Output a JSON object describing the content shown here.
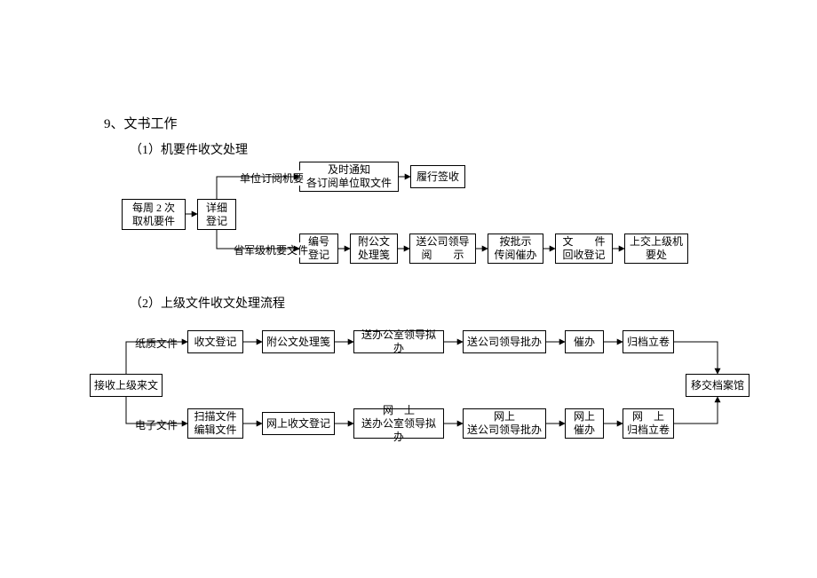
{
  "title": "9、文书工作",
  "section1": {
    "heading": "（1）机要件收文处理",
    "boxes": {
      "weekly": "每周 2 次\n取机要件",
      "register": "详细\n登记",
      "notify": "及时通知\n各订阅单位取文件",
      "signoff": "履行签收",
      "number": "编号\n登记",
      "attach": "附公文\n处理笺",
      "leader": "送公司领导\n阅　　示",
      "instruct": "按批示\n传阅催办",
      "retrieve": "文　　件\n回收登记",
      "submit": "上交上级机\n要处"
    },
    "labels": {
      "unitSubscribe": "单位订阅机要",
      "provinceMilitary": "省军级机要文件"
    }
  },
  "section2": {
    "heading": "（2）上级文件收文处理流程",
    "boxes": {
      "receive": "接收上级来文",
      "recvReg": "收文登记",
      "attachSlip": "附公文处理笺",
      "sendOffice": "送办公室领导拟办",
      "sendLeader": "送公司领导批办",
      "urge": "催办",
      "archive": "归档立卷",
      "scan": "扫描文件\n编辑文件",
      "onlineReg": "网上收文登记",
      "onlineOffice": "网　上\n送办公室领导拟办",
      "onlineLeader": "网上\n送公司领导批办",
      "onlineUrge": "网上\n催办",
      "onlineArchive": "网　上\n归档立卷",
      "transfer": "移交档案馆"
    },
    "labels": {
      "paper": "纸质文件",
      "electronic": "电子文件"
    }
  }
}
